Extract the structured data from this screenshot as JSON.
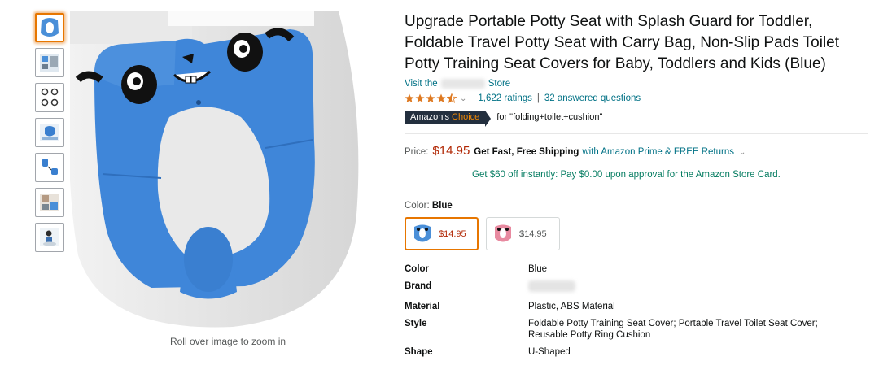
{
  "product": {
    "title": "Upgrade Portable Potty Seat with Splash Guard for Toddler, Foldable Travel Potty Seat with Carry Bag, Non-Slip Pads Toilet Potty Training Seat Covers for Baby, Toddlers and Kids (Blue)",
    "store_prefix": "Visit the",
    "store_suffix": "Store",
    "rating_stars": 4.5,
    "ratings_count": "1,622 ratings",
    "answered": "32 answered questions",
    "badge_main": "Amazon's",
    "badge_choice": "Choice",
    "badge_for": "for \"folding+toilet+cushion\""
  },
  "pricing": {
    "label": "Price:",
    "price": "$14.95",
    "shipping_bold": "Get Fast, Free Shipping",
    "shipping_rest": "with Amazon Prime & FREE Returns",
    "offer": "Get $60 off instantly: Pay $0.00 upon approval for the Amazon Store Card."
  },
  "color": {
    "label": "Color:",
    "selected": "Blue",
    "options": [
      {
        "price": "$14.95",
        "tone": "#4a8fd8"
      },
      {
        "price": "$14.95",
        "tone": "#e88aa0"
      }
    ]
  },
  "specs": [
    {
      "key": "Color",
      "value": "Blue"
    },
    {
      "key": "Brand",
      "value": ""
    },
    {
      "key": "Material",
      "value": "Plastic, ABS Material"
    },
    {
      "key": "Style",
      "value": "Foldable Potty Training Seat Cover; Portable Travel Toilet Seat Cover; Reusable Potty Ring Cushion"
    },
    {
      "key": "Shape",
      "value": "U-Shaped"
    }
  ],
  "image": {
    "zoom_hint": "Roll over image to zoom in"
  },
  "colors": {
    "link": "#007185",
    "price": "#B12704",
    "offer": "#067D62",
    "accent": "#e77600",
    "badge_bg": "#232f3e"
  }
}
